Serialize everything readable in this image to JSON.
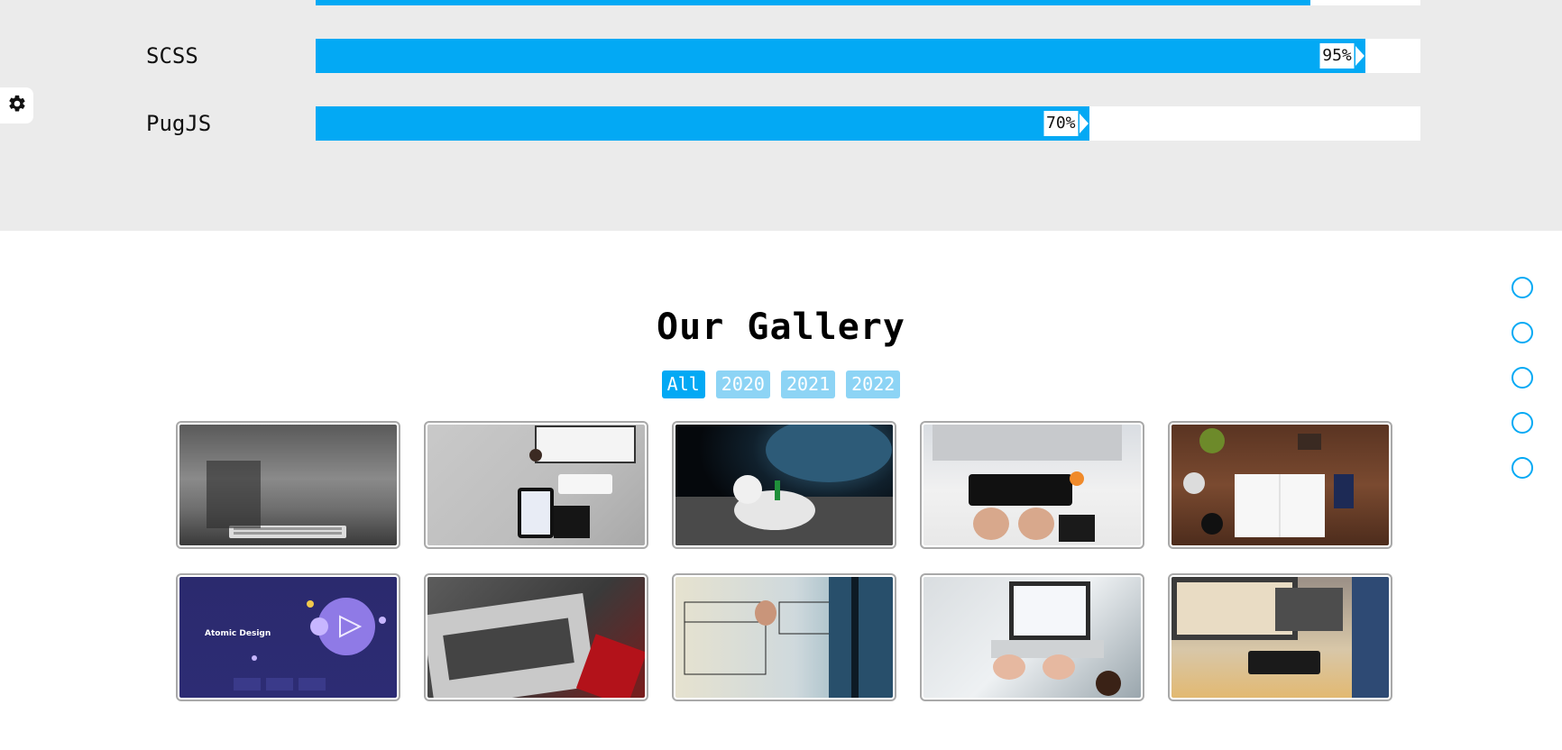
{
  "skills": [
    {
      "name": "",
      "percent": 90,
      "label": ""
    },
    {
      "name": "SCSS",
      "percent": 95,
      "label": "95%"
    },
    {
      "name": "PugJS",
      "percent": 70,
      "label": "70%"
    }
  ],
  "settings": {
    "icon": "gear-icon"
  },
  "gallery": {
    "title": "Our Gallery",
    "filters": [
      {
        "label": "All",
        "active": true
      },
      {
        "label": "2020",
        "active": false
      },
      {
        "label": "2021",
        "active": false
      },
      {
        "label": "2022",
        "active": false
      }
    ],
    "images": [
      "laptop-keyboard-grayscale",
      "desk-tablet-keyboard",
      "astronaut-on-moon",
      "hands-typing-desk",
      "desk-notebook-wood",
      "atomic-design-screen",
      "laptop-dark-desk",
      "wireframe-sketch",
      "laptop-analytics",
      "designer-tablet-desk"
    ],
    "image_text": {
      "atomic_design": "Atomic Design"
    }
  },
  "bullets_count": 5,
  "colors": {
    "accent": "#03a9f4",
    "accent_light": "#8dd4f5",
    "section_bg": "#ebebeb"
  }
}
